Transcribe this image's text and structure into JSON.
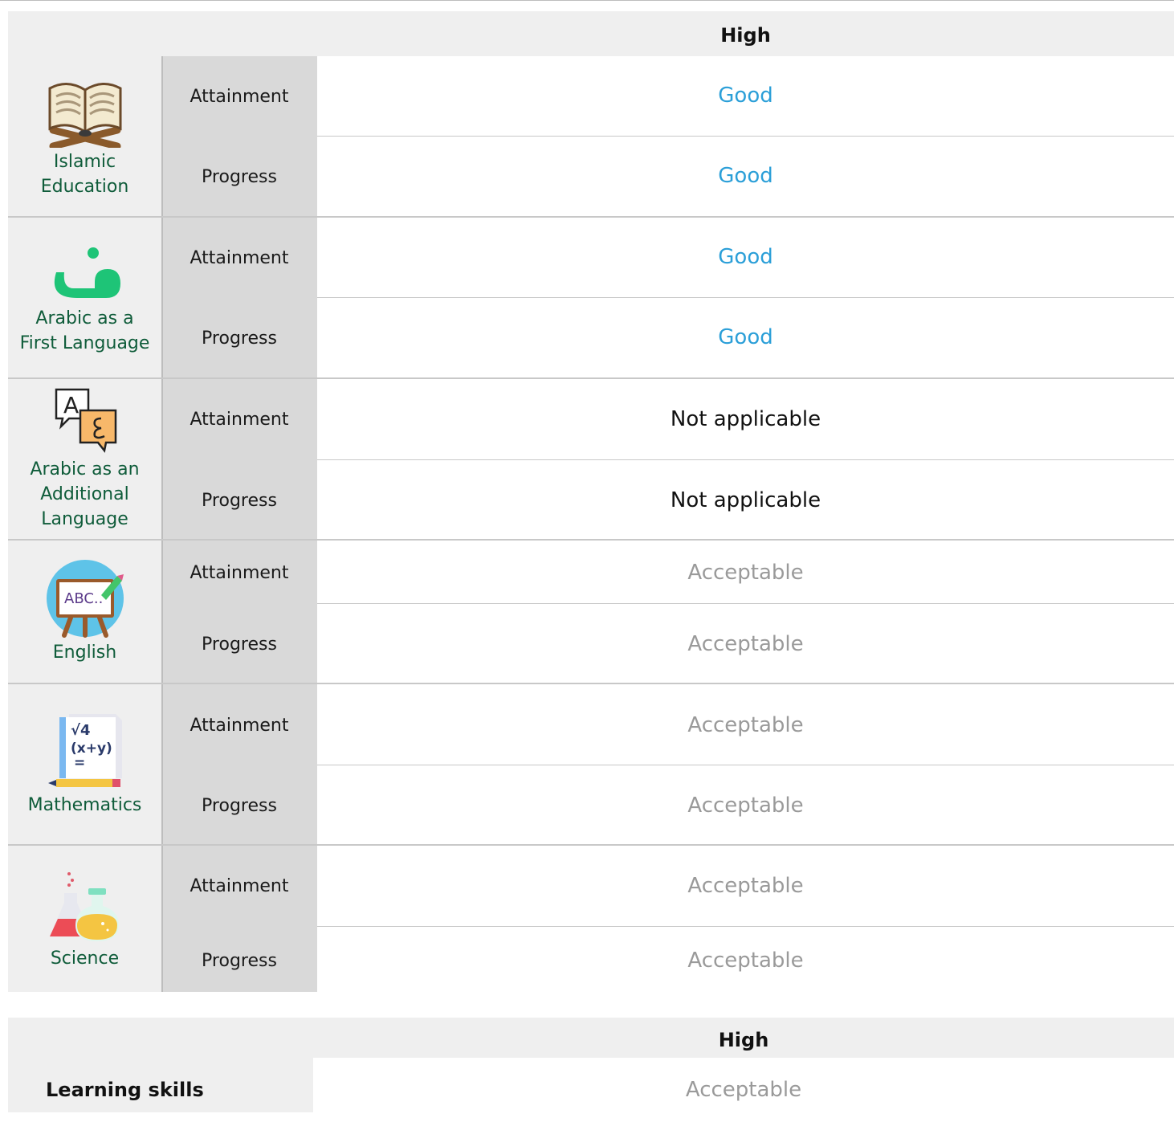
{
  "table": {
    "header": "High",
    "subjects": [
      {
        "name_line1": "Islamic",
        "name_line2": "Education",
        "name_line3": "",
        "icon": "quran-book-icon",
        "attainment_label": "Attainment",
        "attainment": "Good",
        "progress_label": "Progress",
        "progress": "Good"
      },
      {
        "name_line1": "Arabic as a",
        "name_line2": "First Language",
        "name_line3": "",
        "icon": "arabic-letter-icon",
        "attainment_label": "Attainment",
        "attainment": "Good",
        "progress_label": "Progress",
        "progress": "Good"
      },
      {
        "name_line1": "Arabic as an",
        "name_line2": "Additional",
        "name_line3": "Language",
        "icon": "translation-bubbles-icon",
        "attainment_label": "Attainment",
        "attainment": "Not applicable",
        "progress_label": "Progress",
        "progress": "Not applicable"
      },
      {
        "name_line1": "English",
        "name_line2": "",
        "name_line3": "",
        "icon": "abc-easel-icon",
        "attainment_label": "Attainment",
        "attainment": "Acceptable",
        "progress_label": "Progress",
        "progress": "Acceptable"
      },
      {
        "name_line1": "Mathematics",
        "name_line2": "",
        "name_line3": "",
        "icon": "math-notebook-icon",
        "attainment_label": "Attainment",
        "attainment": "Acceptable",
        "progress_label": "Progress",
        "progress": "Acceptable"
      },
      {
        "name_line1": "Science",
        "name_line2": "",
        "name_line3": "",
        "icon": "lab-flasks-icon",
        "attainment_label": "Attainment",
        "attainment": "Acceptable",
        "progress_label": "Progress",
        "progress": "Acceptable"
      }
    ]
  },
  "skills_table": {
    "header": "High",
    "label": "Learning skills",
    "value": "Acceptable"
  },
  "colors": {
    "good": "#2b9fd8",
    "not_applicable": "#111111",
    "acceptable": "#9a9a9a",
    "subject_text": "#0f5c3a"
  }
}
